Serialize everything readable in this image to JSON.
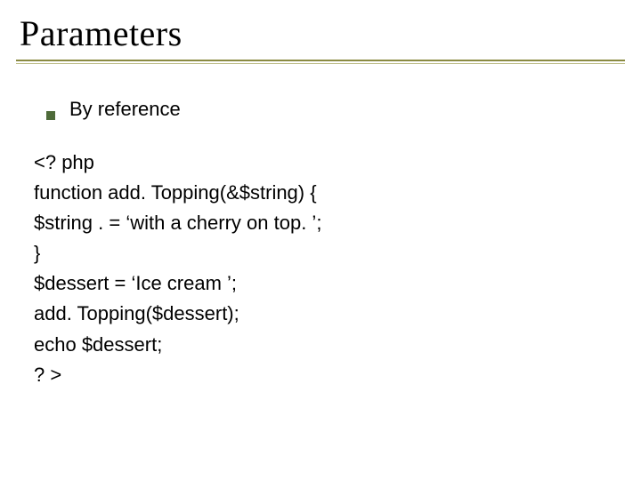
{
  "slide": {
    "title": "Parameters",
    "bullet": "By reference",
    "code": {
      "l1": "<? php",
      "l2": "function add. Topping(&$string) {",
      "l3": "$string . = ‘with a cherry on top. ’;",
      "l4": "}",
      "l5": "$dessert = ‘Ice cream ’;",
      "l6": "add. Topping($dessert);",
      "l7": "echo $dessert;",
      "l8": "? >"
    }
  }
}
